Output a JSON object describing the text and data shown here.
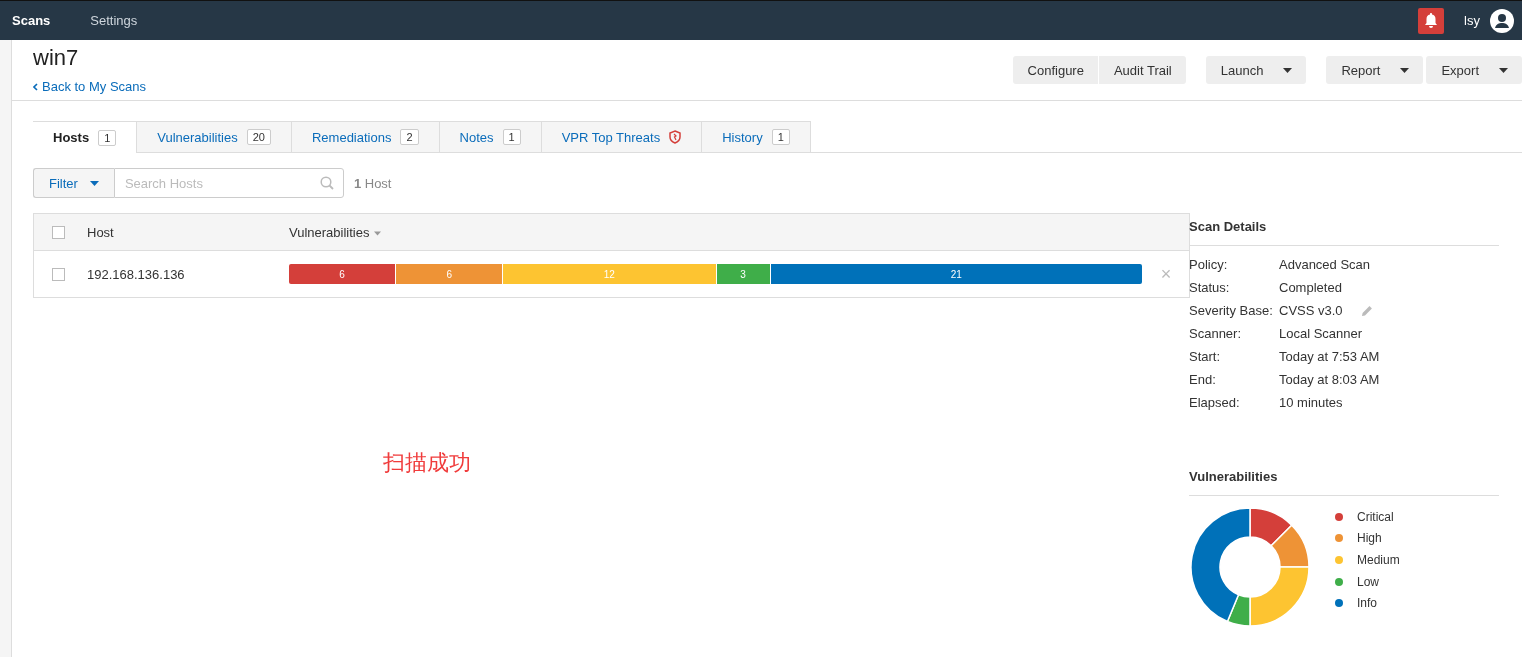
{
  "topbar": {
    "nav": [
      {
        "label": "Scans",
        "selected": true
      },
      {
        "label": "Settings",
        "selected": false
      }
    ],
    "user": "lsy"
  },
  "header": {
    "title": "win7",
    "back_link": "Back to My Scans",
    "button_groups": [
      [
        {
          "label": "Configure",
          "dropdown": false
        },
        {
          "label": "Audit Trail",
          "dropdown": false
        }
      ],
      [
        {
          "label": "Launch",
          "dropdown": true
        }
      ],
      [
        {
          "label": "Report",
          "dropdown": true
        },
        {
          "label": "Export",
          "dropdown": true
        }
      ]
    ]
  },
  "tabs": [
    {
      "label": "Hosts",
      "count": "1",
      "selected": true
    },
    {
      "label": "Vulnerabilities",
      "count": "20",
      "selected": false
    },
    {
      "label": "Remediations",
      "count": "2",
      "selected": false
    },
    {
      "label": "Notes",
      "count": "1",
      "selected": false
    },
    {
      "label": "VPR Top Threats",
      "kind": "shield",
      "selected": false
    },
    {
      "label": "History",
      "count": "1",
      "selected": false
    }
  ],
  "filter": {
    "label": "Filter",
    "placeholder": "Search Hosts",
    "count": "1",
    "count_label": "Host"
  },
  "table": {
    "columns": [
      "Host",
      "Vulnerabilities"
    ],
    "rows": [
      {
        "host": "192.168.136.136",
        "checked": false,
        "remove": "×",
        "segments": [
          {
            "count": "6",
            "color": "#d43f3a"
          },
          {
            "count": "6",
            "color": "#ee9336"
          },
          {
            "count": "12",
            "color": "#fdc431"
          },
          {
            "count": "3",
            "color": "#3fae49"
          },
          {
            "count": "21",
            "color": "#0071b9"
          }
        ]
      }
    ],
    "header_checked": false
  },
  "annotation": "扫描成功",
  "scan_details": {
    "title": "Scan Details",
    "rows": [
      {
        "label": "Policy:",
        "value": "Advanced Scan"
      },
      {
        "label": "Status:",
        "value": "Completed"
      },
      {
        "label": "Severity Base:",
        "value": "CVSS v3.0",
        "editable": true
      },
      {
        "label": "Scanner:",
        "value": "Local Scanner"
      },
      {
        "label": "Start:",
        "value": "Today at 7:53 AM"
      },
      {
        "label": "End:",
        "value": "Today at 8:03 AM"
      },
      {
        "label": "Elapsed:",
        "value": "10 minutes"
      }
    ]
  },
  "vulnerabilities": {
    "title": "Vulnerabilities",
    "legend": [
      {
        "label": "Critical",
        "color": "#d43f3a"
      },
      {
        "label": "High",
        "color": "#ee9336"
      },
      {
        "label": "Medium",
        "color": "#fdc431"
      },
      {
        "label": "Low",
        "color": "#3fae49"
      },
      {
        "label": "Info",
        "color": "#0071b9"
      }
    ]
  }
}
